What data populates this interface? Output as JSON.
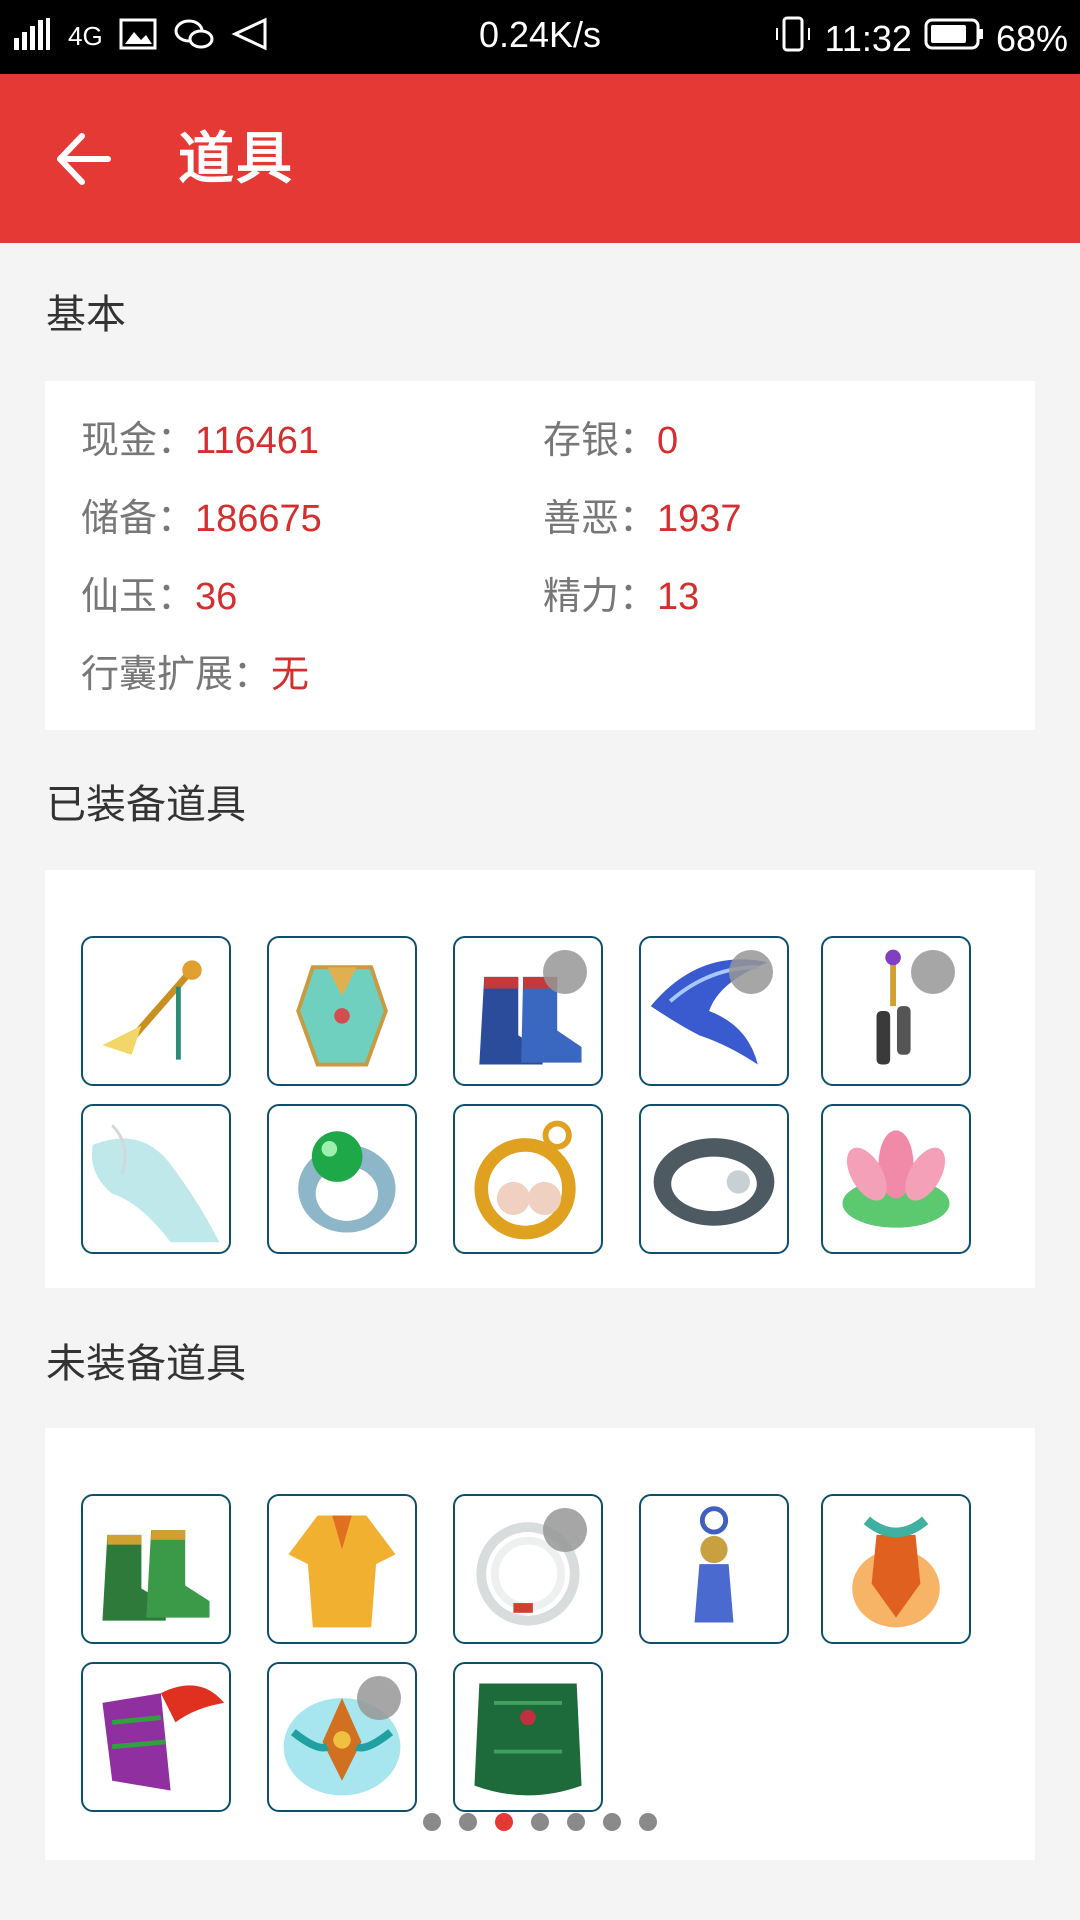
{
  "status_bar": {
    "network": "4G",
    "speed": "0.24K/s",
    "time": "11:32",
    "battery": "68%"
  },
  "app_bar": {
    "title": "道具"
  },
  "basic": {
    "title": "基本",
    "stats": [
      {
        "label": "现金：",
        "value": "116461"
      },
      {
        "label": "存银：",
        "value": "0"
      },
      {
        "label": "储备：",
        "value": "186675"
      },
      {
        "label": "善恶：",
        "value": "1937"
      },
      {
        "label": "仙玉：",
        "value": "36"
      },
      {
        "label": "精力：",
        "value": "13"
      },
      {
        "label": "行囊扩展：",
        "value": "无"
      }
    ]
  },
  "equipped": {
    "title": "已装备道具",
    "items": [
      {
        "icon": "weapon-staff-icon",
        "locked": false
      },
      {
        "icon": "robe-armor-icon",
        "locked": false
      },
      {
        "icon": "boots-icon",
        "locked": true
      },
      {
        "icon": "ribbon-belt-icon",
        "locked": true
      },
      {
        "icon": "bell-pendant-icon",
        "locked": true
      },
      {
        "icon": "mist-ornament-icon",
        "locked": false
      },
      {
        "icon": "jade-ring-icon",
        "locked": false
      },
      {
        "icon": "pearl-earrings-icon",
        "locked": false
      },
      {
        "icon": "stone-bracelet-icon",
        "locked": false
      },
      {
        "icon": "lotus-icon",
        "locked": false
      }
    ]
  },
  "unequipped": {
    "title": "未装备道具",
    "items": [
      {
        "icon": "green-boots-icon",
        "locked": false
      },
      {
        "icon": "golden-robe-icon",
        "locked": false
      },
      {
        "icon": "white-coil-icon",
        "locked": true
      },
      {
        "icon": "tassel-charm-icon",
        "locked": false
      },
      {
        "icon": "flame-talisman-icon",
        "locked": false
      },
      {
        "icon": "feather-armor-icon",
        "locked": false
      },
      {
        "icon": "winged-crown-icon",
        "locked": true
      },
      {
        "icon": "green-vest-icon",
        "locked": false
      }
    ]
  },
  "pagination": {
    "count": 7,
    "active": 2
  },
  "colors": {
    "accent": "#e53935",
    "value": "#d32f2f",
    "item_border": "#0d4f6d"
  }
}
